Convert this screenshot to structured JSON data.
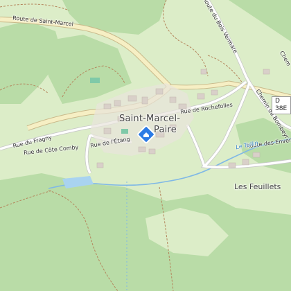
{
  "map": {
    "colors": {
      "land": "#dcedc8",
      "forest": "#b9dca7",
      "road_major": "#f6efc4",
      "road_casing": "#c9b98a",
      "road_minor": "#ffffff",
      "path": "#b4855c",
      "water": "#a9d3f0",
      "river": "#7fb8e6",
      "building": "#d9d0c9",
      "pin": "#2c7be5"
    },
    "labels": {
      "road_saint_marcel": "Route de Saint-Marcel",
      "town": "Saint-Marcel-Paire",
      "town_line1": "Saint-Marcel-",
      "town_line2": "Paire",
      "rue_rochefolles": "Rue de Rochefolles",
      "rue_fragny": "Rue du Fragny",
      "rue_cote_comby": "Rue de Côte Comby",
      "rue_etang": "Rue de l'Étang",
      "route_bois_vermare": "Route du Bois Vermare",
      "chemin_bombeyr": "Chemin du Bombeyr",
      "chemin_top": "Chem",
      "route_envers": "Route des Envers",
      "le_tullin": "Le Tullin",
      "les_feuillets": "Les Feuillets",
      "d38e": "D 38E"
    },
    "icons": {
      "pin": "location-pin-icon"
    }
  }
}
